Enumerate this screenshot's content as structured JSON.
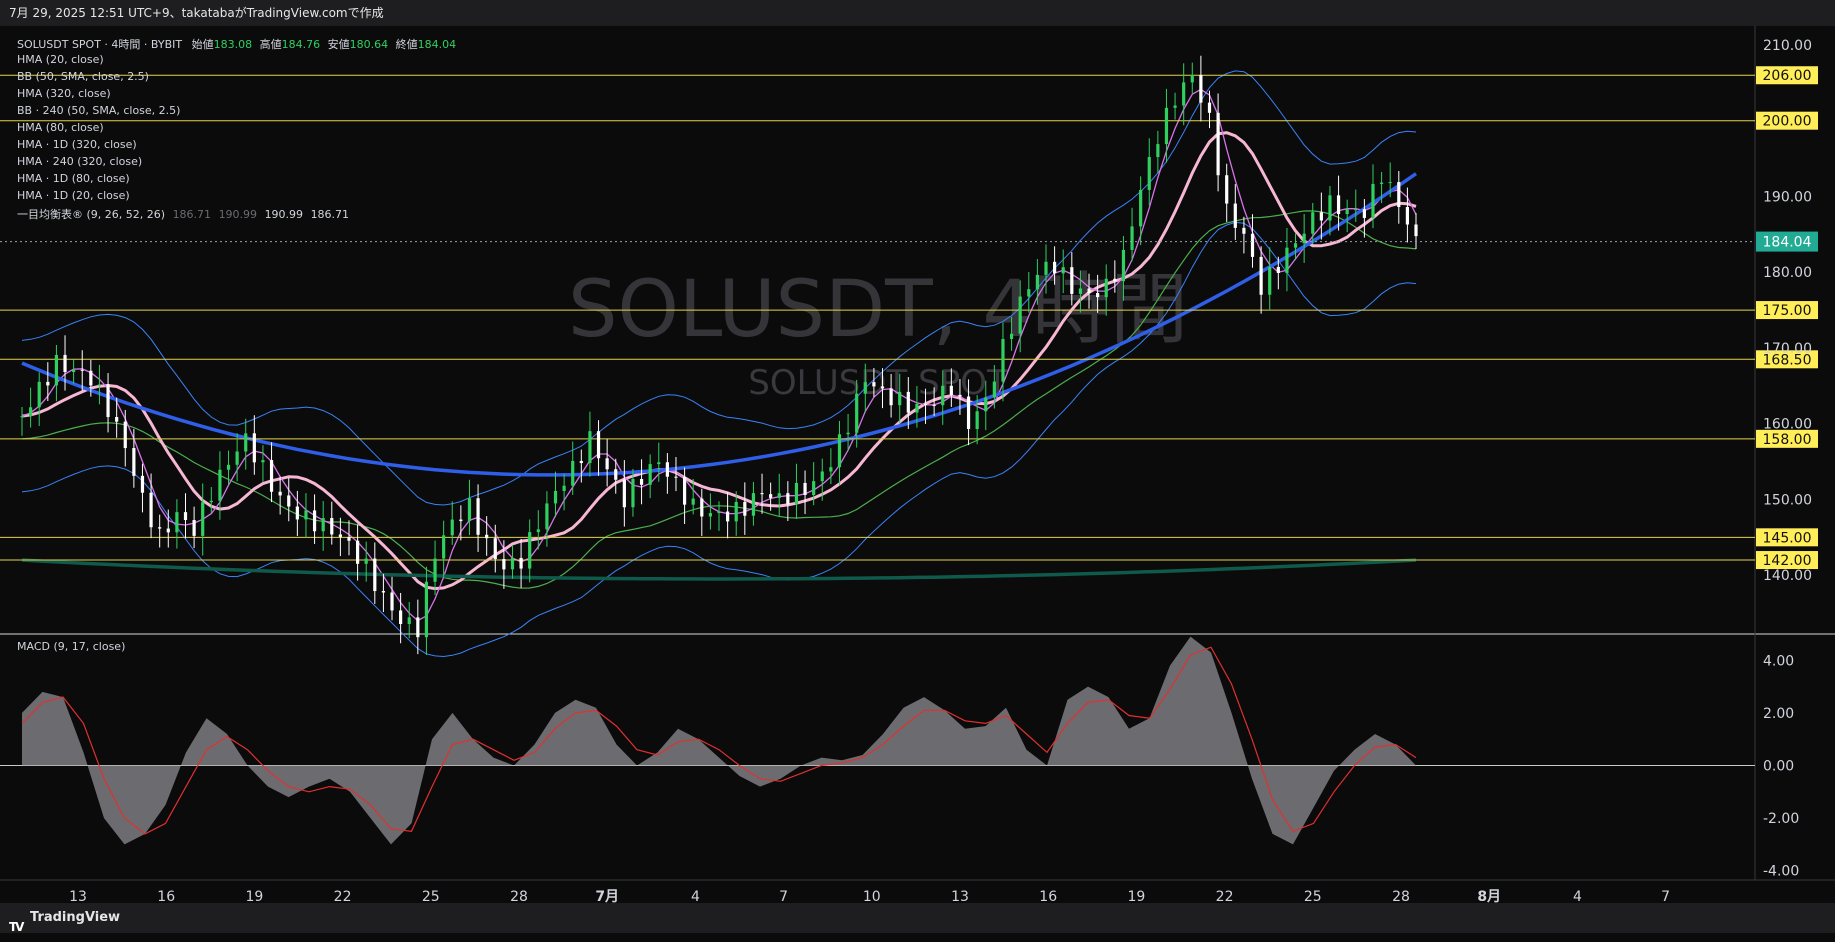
{
  "header": {
    "text": "7月 29, 2025 12:51 UTC+9、takatabaがTradingView.comで作成"
  },
  "watermark": {
    "main": "SOLUSDT, 4時間",
    "sub": "SOLUSDT SPOT"
  },
  "legend": {
    "symbol_line": "SOLUSDT SPOT · 4時間 · BYBIT",
    "ohlc": [
      {
        "label": "始値",
        "value": "183.08"
      },
      {
        "label": "高値",
        "value": "184.76"
      },
      {
        "label": "安値",
        "value": "180.64"
      },
      {
        "label": "終値",
        "value": "184.04"
      }
    ],
    "indicators": [
      "HMA (20, close)",
      "BB (50, SMA, close, 2.5)",
      "HMA (320, close)",
      "BB · 240 (50, SMA, close, 2.5)",
      "HMA (80, close)",
      "HMA · 1D (320, close)",
      "HMA · 240 (320, close)",
      "HMA · 1D (80, close)",
      "HMA · 1D (20, close)"
    ],
    "ichimoku": {
      "label": "一目均衡表® (9, 26, 52, 26)",
      "values_muted": [
        "186.71",
        "190.99"
      ],
      "values": [
        "190.99",
        "186.71"
      ]
    }
  },
  "macd_label": "MACD (9, 17, close)",
  "footer": {
    "logo": "TV",
    "text": "TradingView"
  },
  "colors": {
    "background": "#0b0b0c",
    "bull": "#2fd05f",
    "bear": "#ffffff",
    "level_line": "#e6d34a",
    "level_label_bg": "#ffee58",
    "price_label_bg": "#22ab94",
    "hma20": "#d873e8",
    "hma80": "#f7b7d3",
    "hma320_daily": "#2f5fe8",
    "bb_line": "#3b82f6",
    "hma_green": "#4cae4c",
    "hma_teal": "#0f5a4a",
    "macd_line": "#e03030",
    "macd_hist": "#8d8d92"
  },
  "chart_data": [
    {
      "type": "candlestick",
      "title": "SOLUSDT SPOT · 4時間 · BYBIT",
      "y_axis_ticks": [
        "210.00",
        "190.00",
        "180.00",
        "170.00",
        "160.00",
        "150.00",
        "140.00"
      ],
      "ylim": [
        132.5,
        212.5
      ],
      "price_label": "184.04",
      "horizontal_levels": [
        "206.00",
        "200.00",
        "175.00",
        "168.50",
        "158.00",
        "145.00",
        "142.00"
      ],
      "x_tick_labels": [
        "13",
        "16",
        "19",
        "22",
        "25",
        "28",
        "7月",
        "4",
        "7",
        "10",
        "13",
        "16",
        "19",
        "22",
        "25",
        "28",
        "8月",
        "4",
        "7"
      ],
      "price_path": [
        [
          0,
          161
        ],
        [
          2,
          168
        ],
        [
          4,
          166
        ],
        [
          5,
          162
        ],
        [
          6,
          157
        ],
        [
          7,
          150
        ],
        [
          8,
          145
        ],
        [
          9,
          148
        ],
        [
          10,
          146
        ],
        [
          11,
          151
        ],
        [
          12,
          155
        ],
        [
          13,
          158
        ],
        [
          14,
          154
        ],
        [
          15,
          150
        ],
        [
          16,
          148
        ],
        [
          17,
          147
        ],
        [
          18,
          146
        ],
        [
          19,
          144
        ],
        [
          20,
          141
        ],
        [
          21,
          137
        ],
        [
          22,
          134
        ],
        [
          23,
          133
        ],
        [
          24,
          143
        ],
        [
          25,
          147
        ],
        [
          26,
          149
        ],
        [
          27,
          144
        ],
        [
          28,
          141
        ],
        [
          29,
          142
        ],
        [
          30,
          147
        ],
        [
          31,
          151
        ],
        [
          32,
          154
        ],
        [
          33,
          158
        ],
        [
          34,
          154
        ],
        [
          35,
          150
        ],
        [
          36,
          153
        ],
        [
          37,
          155
        ],
        [
          38,
          152
        ],
        [
          39,
          149
        ],
        [
          40,
          148
        ],
        [
          41,
          148
        ],
        [
          42,
          149
        ],
        [
          43,
          151
        ],
        [
          44,
          150
        ],
        [
          45,
          151
        ],
        [
          46,
          152
        ],
        [
          47,
          155
        ],
        [
          48,
          160
        ],
        [
          49,
          166
        ],
        [
          50,
          164
        ],
        [
          51,
          163
        ],
        [
          52,
          162
        ],
        [
          53,
          163
        ],
        [
          54,
          165
        ],
        [
          55,
          160
        ],
        [
          56,
          163
        ],
        [
          57,
          170
        ],
        [
          58,
          176
        ],
        [
          59,
          180
        ],
        [
          60,
          181
        ],
        [
          61,
          178
        ],
        [
          62,
          177
        ],
        [
          63,
          178
        ],
        [
          64,
          182
        ],
        [
          65,
          191
        ],
        [
          66,
          198
        ],
        [
          67,
          203
        ],
        [
          68,
          206
        ],
        [
          69,
          200
        ],
        [
          70,
          188
        ],
        [
          71,
          185
        ],
        [
          72,
          178
        ],
        [
          73,
          181
        ],
        [
          74,
          184
        ],
        [
          75,
          187
        ],
        [
          76,
          189
        ],
        [
          77,
          188
        ],
        [
          78,
          188
        ],
        [
          79,
          193
        ],
        [
          80,
          189
        ],
        [
          81,
          184
        ]
      ],
      "x_end_index": 81,
      "x_view_max": 100
    },
    {
      "type": "area",
      "title": "MACD (9, 17, close)",
      "y_axis_ticks": [
        "4.00",
        "2.00",
        "0.00",
        "-2.00",
        "-4.00"
      ],
      "ylim": [
        -4.2,
        5.0
      ],
      "series": [
        {
          "name": "MACD",
          "values": [
            2.0,
            2.8,
            2.6,
            0.5,
            -2.0,
            -3.0,
            -2.6,
            -1.5,
            0.5,
            1.8,
            1.2,
            0.0,
            -0.8,
            -1.2,
            -0.8,
            -0.5,
            -1.0,
            -2.0,
            -3.0,
            -2.2,
            1.0,
            2.0,
            1.0,
            0.3,
            0.0,
            0.8,
            2.0,
            2.5,
            2.2,
            0.8,
            0.0,
            0.5,
            1.4,
            1.0,
            0.3,
            -0.4,
            -0.8,
            -0.5,
            0.0,
            0.3,
            0.2,
            0.4,
            1.2,
            2.2,
            2.6,
            2.1,
            1.4,
            1.5,
            2.2,
            0.6,
            0.0,
            2.5,
            3.0,
            2.6,
            1.4,
            1.8,
            3.8,
            4.9,
            4.3,
            2.0,
            -0.5,
            -2.6,
            -3.0,
            -1.6,
            -0.2,
            0.6,
            1.2,
            0.8,
            0.0
          ]
        },
        {
          "name": "Signal",
          "values": [
            1.6,
            2.4,
            2.6,
            1.6,
            -0.5,
            -2.0,
            -2.6,
            -2.2,
            -0.8,
            0.6,
            1.1,
            0.6,
            -0.2,
            -0.8,
            -1.0,
            -0.8,
            -0.9,
            -1.5,
            -2.4,
            -2.5,
            -0.8,
            0.8,
            1.0,
            0.6,
            0.2,
            0.5,
            1.4,
            2.0,
            2.1,
            1.5,
            0.6,
            0.4,
            0.9,
            1.0,
            0.6,
            0.0,
            -0.5,
            -0.6,
            -0.3,
            0.0,
            0.1,
            0.3,
            0.8,
            1.5,
            2.1,
            2.1,
            1.7,
            1.6,
            1.9,
            1.2,
            0.5,
            1.6,
            2.4,
            2.5,
            1.9,
            1.8,
            2.9,
            4.2,
            4.5,
            3.1,
            1.0,
            -1.3,
            -2.5,
            -2.2,
            -1.0,
            0.0,
            0.7,
            0.8,
            0.3
          ]
        }
      ]
    }
  ]
}
